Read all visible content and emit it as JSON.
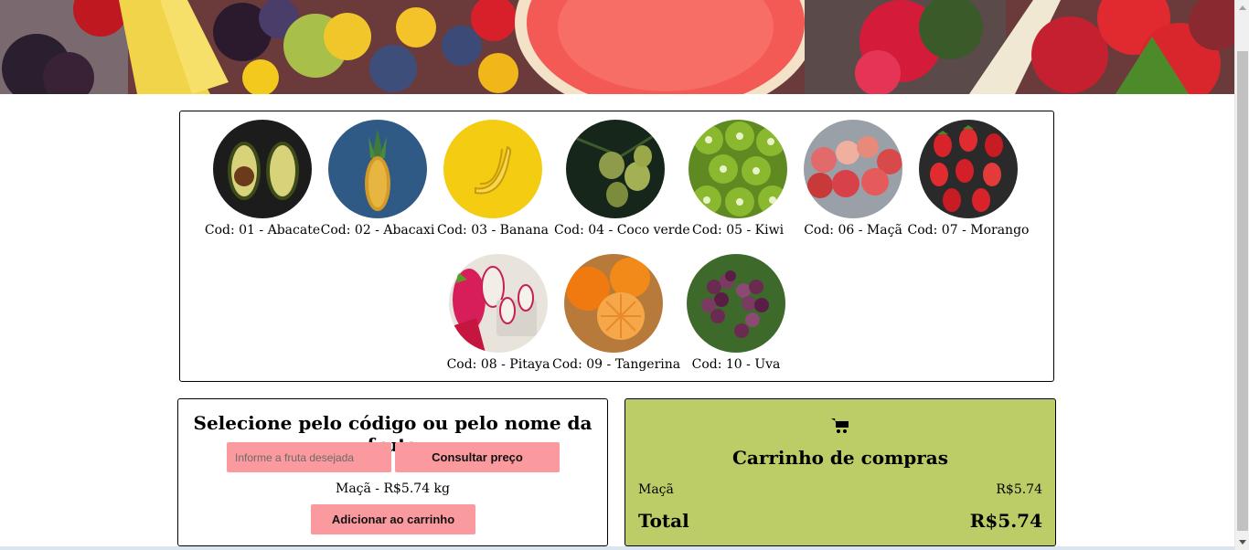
{
  "banner": {
    "icon": "fruit-salad-banner-image"
  },
  "fruits": [
    {
      "label": "Cod: 01 - Abacate"
    },
    {
      "label": "Cod: 02 - Abacaxi"
    },
    {
      "label": "Cod: 03 - Banana"
    },
    {
      "label": "Cod: 04 - Coco verde"
    },
    {
      "label": "Cod: 05 - Kiwi"
    },
    {
      "label": "Cod: 06 - Maçã"
    },
    {
      "label": "Cod: 07 - Morango"
    },
    {
      "label": "Cod: 08 - Pitaya"
    },
    {
      "label": "Cod: 09 - Tangerina"
    },
    {
      "label": "Cod: 10 - Uva"
    }
  ],
  "select": {
    "title": "Selecione pelo código ou pelo nome da fruta",
    "input_placeholder": "Informe a fruta desejada",
    "input_value": "",
    "consult_label": "Consultar preço",
    "result_text": "Maçã - R$5.74 kg",
    "add_label": "Adicionar ao carrinho"
  },
  "cart": {
    "icon": "shopping-cart-icon",
    "title": "Carrinho de compras",
    "items": [
      {
        "name": "Maçã",
        "price": "R$5.74"
      }
    ],
    "total_label": "Total",
    "total_value": "R$5.74"
  },
  "colors": {
    "button_pink": "#fa9a9f",
    "cart_green": "#bccc67"
  }
}
